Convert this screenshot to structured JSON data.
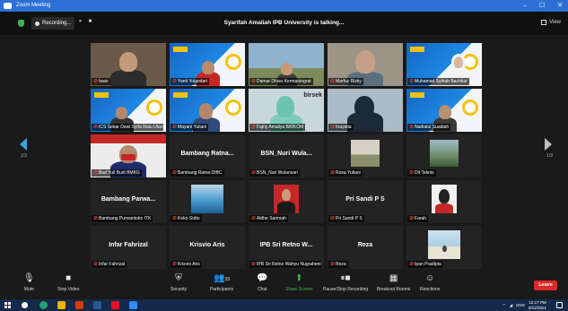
{
  "window": {
    "title": "Zoom Meeting",
    "controls": [
      "–",
      "☐",
      "✕"
    ]
  },
  "topbar": {
    "recording_label": "Recording...",
    "recording_controls": "⏸ ■",
    "speaking": "Syarifah Amaliah IPB University is talking...",
    "view_label": "View"
  },
  "colors": {
    "accent": "#2d6fd6",
    "share_green": "#3bb54a",
    "leave_red": "#e02828",
    "muted_mic": "#e0413b"
  },
  "gallery": {
    "page_left": "1/3",
    "page_right": "1/3",
    "tiles": [
      {
        "name": "Iwan",
        "kind": "video"
      },
      {
        "name": "Yanti Yolandari",
        "kind": "slide"
      },
      {
        "name": "Damar Dhiva Kermaningrat",
        "kind": "video"
      },
      {
        "name": "Marfuz Rizky",
        "kind": "video"
      },
      {
        "name": "Muhamad Syihab Bachtiar",
        "kind": "slide"
      },
      {
        "name": "ICS Sekar Dewi Syifa Ratu Utama",
        "kind": "slide"
      },
      {
        "name": "Mayani Yuliani",
        "kind": "slide"
      },
      {
        "name": "Fajriy Amaliya BIRKOM",
        "kind": "video"
      },
      {
        "name": "Inayatia",
        "kind": "video"
      },
      {
        "name": "Nadiatul Suaibah",
        "kind": "slide"
      },
      {
        "name": "Bud Yuli Budi BMKG",
        "kind": "video"
      },
      {
        "name": "Bambang Ratna DIBC",
        "kind": "text",
        "display": "Bambang Ratna..."
      },
      {
        "name": "BSN_Nuri Wulansari",
        "kind": "text",
        "display": "BSN_Nuri Wula..."
      },
      {
        "name": "Rosa Yuliani",
        "kind": "image"
      },
      {
        "name": "Dit Teknis",
        "kind": "image"
      },
      {
        "name": "Bambang Purwantoko ITK",
        "kind": "text",
        "display": "Bambang Parwa..."
      },
      {
        "name": "Koko Sutto",
        "kind": "image"
      },
      {
        "name": "Aldhe Sarimah",
        "kind": "image"
      },
      {
        "name": "Pri Sandi P S",
        "kind": "text",
        "display": "Pri Sandi P S"
      },
      {
        "name": "Farah",
        "kind": "image"
      },
      {
        "name": "Infar Fahrizal",
        "kind": "text",
        "display": "Infar Fahrizal"
      },
      {
        "name": "Krisvio Aris",
        "kind": "text",
        "display": "Krisvio Aris"
      },
      {
        "name": "IPB Sri Retno Wahyu Nugraheni",
        "kind": "text",
        "display": "IPB Sri Retno W..."
      },
      {
        "name": "Reza",
        "kind": "text",
        "display": "Reza"
      },
      {
        "name": "Ipan Pradipta",
        "kind": "image"
      }
    ]
  },
  "toolbar": {
    "mute": "Mute",
    "stop_video": "Stop Video",
    "security": "Security",
    "participants": "Participants",
    "participants_count": "33",
    "chat": "Chat",
    "share_screen": "Share Screen",
    "pause_recording": "Pause/Stop Recording",
    "breakout": "Breakout Rooms",
    "reactions": "Reactions",
    "leave": "Leave"
  },
  "taskbar": {
    "tray_text": "ENG",
    "time": "12:17 PM",
    "date": "8/12/2021"
  }
}
